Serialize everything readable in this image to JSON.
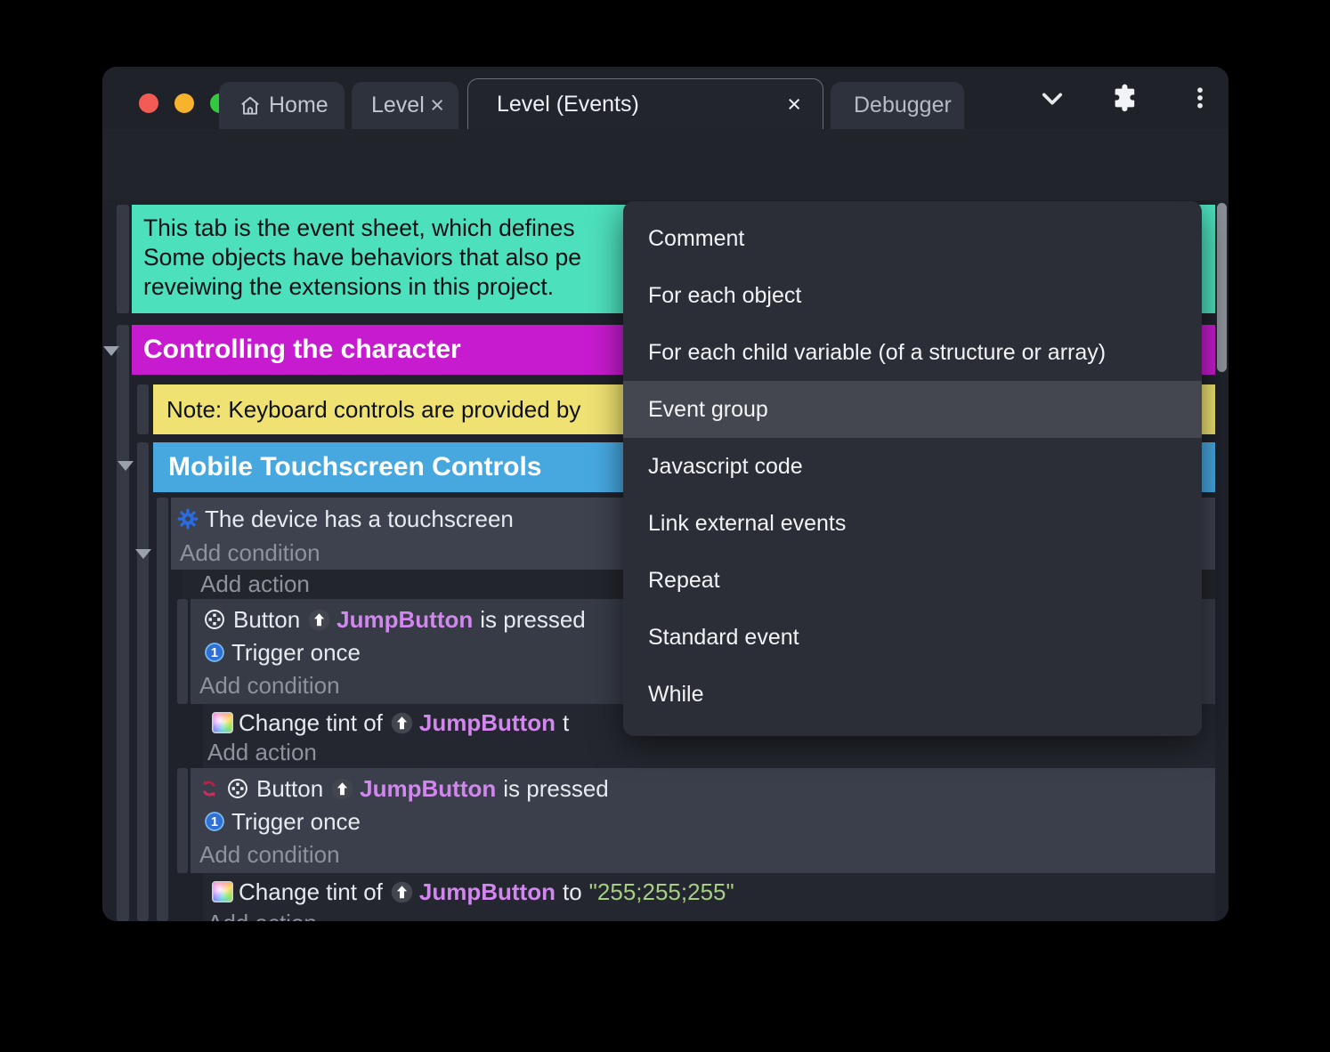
{
  "titlebar": {
    "tabs": {
      "home": "Home",
      "level": "Level",
      "events": "Level (Events)",
      "debugger": "Debugger"
    },
    "close_glyph": "×"
  },
  "sheet": {
    "comment_top": {
      "line1": "This tab is the event sheet, which defines",
      "line2": "Some objects have behaviors that also pe",
      "line3": "reveiwing the extensions in this project."
    },
    "group_controlling": "Controlling the character",
    "note_keyboard": "Note: Keyboard controls are provided by",
    "group_mobile": "Mobile Touchscreen Controls",
    "add_condition": "Add condition",
    "add_action": "Add action",
    "event_touchscreen": {
      "condition": "The device has a touchscreen"
    },
    "event_button1": {
      "prefix": "Button",
      "object": "JumpButton",
      "suffix": "is pressed",
      "trigger": "Trigger once"
    },
    "action_tint1": {
      "prefix": "Change tint of",
      "object": "JumpButton",
      "suffix": "t"
    },
    "event_button2": {
      "prefix": "Button",
      "object": "JumpButton",
      "suffix": "is pressed",
      "trigger": "Trigger once"
    },
    "action_tint2": {
      "prefix": "Change tint of",
      "object": "JumpButton",
      "to": "to",
      "value": "\"255;255;255\""
    }
  },
  "menu": {
    "items": [
      {
        "label": "Comment",
        "highlighted": false
      },
      {
        "label": "For each object",
        "highlighted": false
      },
      {
        "label": "For each child variable (of a structure or array)",
        "highlighted": false
      },
      {
        "label": "Event group",
        "highlighted": true
      },
      {
        "label": "Javascript code",
        "highlighted": false
      },
      {
        "label": "Link external events",
        "highlighted": false
      },
      {
        "label": "Repeat",
        "highlighted": false
      },
      {
        "label": "Standard event",
        "highlighted": false
      },
      {
        "label": "While",
        "highlighted": false
      }
    ]
  },
  "colors": {
    "comment_teal": "#4de0bd",
    "group_magenta": "#c61bce",
    "note_yellow": "#efe272",
    "group_blue": "#47a8e0",
    "object_violet": "#d287ef",
    "string_green": "#a6cf82",
    "accent_purple": "#5a2ae2",
    "menu_highlight": "#44474f",
    "traffic_red": "#f25c54",
    "traffic_yellow": "#f7b32b",
    "traffic_green": "#30c940"
  }
}
